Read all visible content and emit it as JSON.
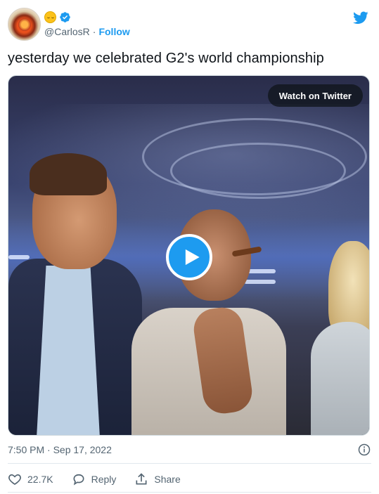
{
  "tweet": {
    "handle": "@CarlosR",
    "separator": "·",
    "follow_label": "Follow",
    "text": "yesterday we celebrated G2's world championship",
    "timestamp": "7:50 PM · Sep 17, 2022"
  },
  "media": {
    "watch_label": "Watch on Twitter"
  },
  "actions": {
    "like_count": "22.7K",
    "reply_label": "Reply",
    "share_label": "Share"
  },
  "icons": {
    "brand": "twitter-bird-icon",
    "verified": "verified-badge-icon",
    "emoji": "relieved-face-emoji-icon",
    "play": "play-icon",
    "info": "info-icon",
    "like": "heart-icon",
    "reply": "reply-bubble-icon",
    "share": "share-icon"
  },
  "colors": {
    "accent": "#1d9bf0",
    "text": "#0f1419",
    "muted": "#536471"
  }
}
